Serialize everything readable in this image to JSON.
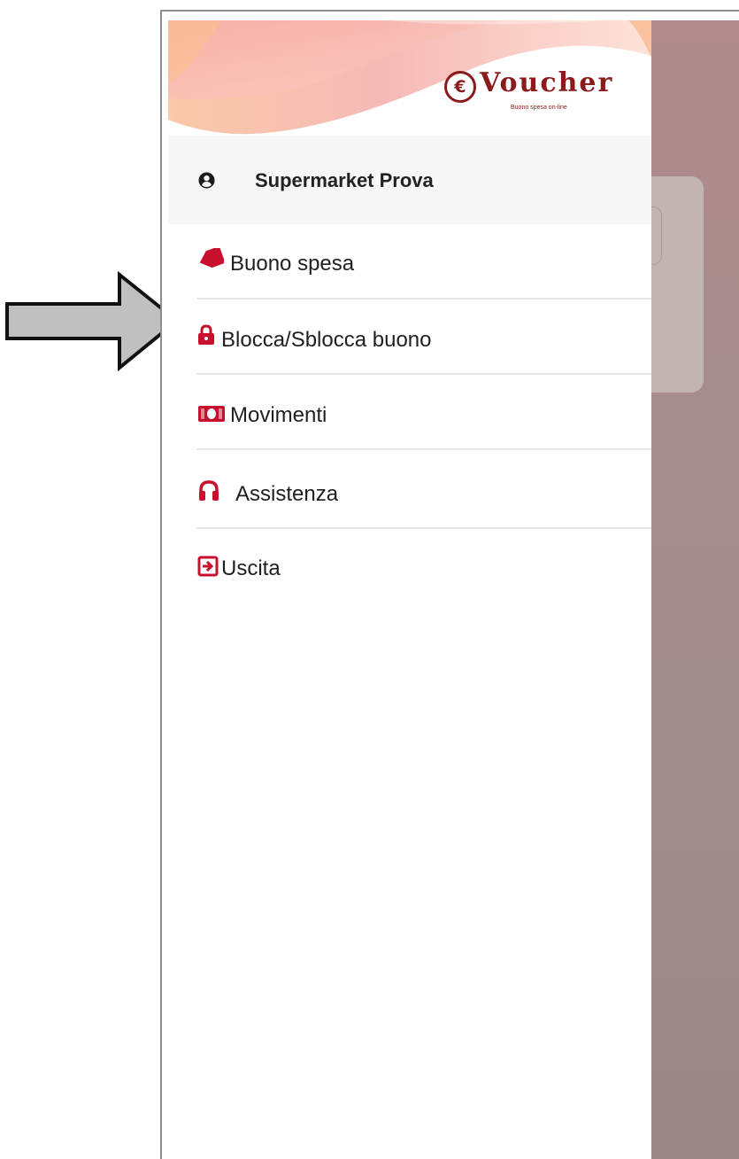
{
  "brand": {
    "name": "Voucher",
    "tagline": "Buono spesa on-line",
    "icon": "euro-coin-icon",
    "color": "#8b1a1a"
  },
  "user": {
    "name": "Supermarket Prova",
    "icon": "user-circle-icon"
  },
  "menu": {
    "items": [
      {
        "label": "Buono spesa",
        "icon": "tag-icon"
      },
      {
        "label": "Blocca/Sblocca buono",
        "icon": "lock-icon"
      },
      {
        "label": "Movimenti",
        "icon": "money-bill-icon"
      },
      {
        "label": "Assistenza",
        "icon": "headphones-icon"
      },
      {
        "label": "Uscita",
        "icon": "sign-out-icon"
      }
    ],
    "icon_color": "#c8102e"
  },
  "annotation": {
    "icon": "pointer-arrow-icon",
    "color": "#c0c0c0"
  }
}
